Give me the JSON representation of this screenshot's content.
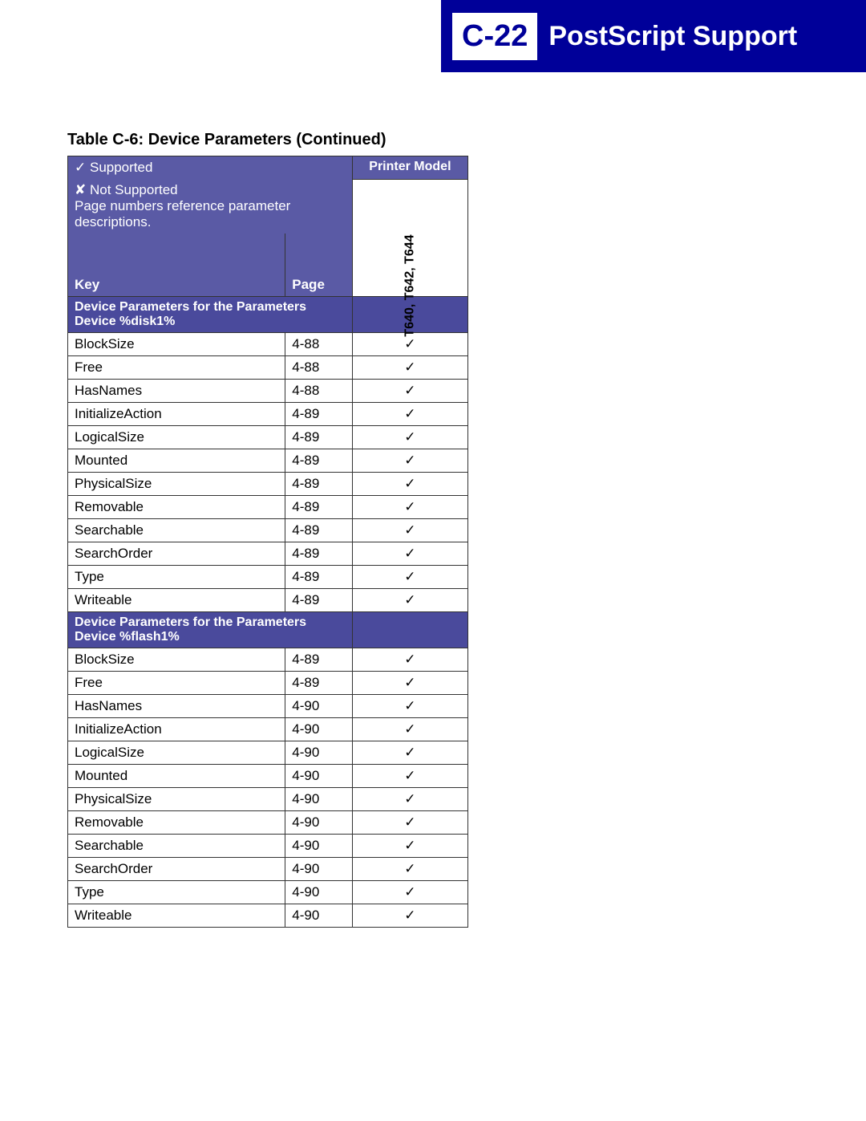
{
  "header": {
    "page_number": "C-22",
    "title": "PostScript Support"
  },
  "caption": "Table C-6:  Device Parameters (Continued)",
  "legend": {
    "supported": "Supported",
    "not_supported": "Not Supported",
    "note": "Page numbers reference parameter descriptions."
  },
  "columns": {
    "key": "Key",
    "page": "Page",
    "printer_model": "Printer Model",
    "model_label": "T640, T642, T644"
  },
  "sections": [
    {
      "heading": "Device Parameters for the Parameters Device %disk1%",
      "rows": [
        {
          "key": "BlockSize",
          "page": "4-88",
          "supported": true
        },
        {
          "key": "Free",
          "page": "4-88",
          "supported": true
        },
        {
          "key": "HasNames",
          "page": "4-88",
          "supported": true
        },
        {
          "key": "InitializeAction",
          "page": "4-89",
          "supported": true
        },
        {
          "key": "LogicalSize",
          "page": "4-89",
          "supported": true
        },
        {
          "key": "Mounted",
          "page": "4-89",
          "supported": true
        },
        {
          "key": "PhysicalSize",
          "page": "4-89",
          "supported": true
        },
        {
          "key": "Removable",
          "page": "4-89",
          "supported": true
        },
        {
          "key": "Searchable",
          "page": "4-89",
          "supported": true
        },
        {
          "key": "SearchOrder",
          "page": "4-89",
          "supported": true
        },
        {
          "key": "Type",
          "page": "4-89",
          "supported": true
        },
        {
          "key": "Writeable",
          "page": "4-89",
          "supported": true
        }
      ]
    },
    {
      "heading": "Device Parameters for the Parameters Device %flash1%",
      "rows": [
        {
          "key": "BlockSize",
          "page": "4-89",
          "supported": true
        },
        {
          "key": "Free",
          "page": "4-89",
          "supported": true
        },
        {
          "key": "HasNames",
          "page": "4-90",
          "supported": true
        },
        {
          "key": "InitializeAction",
          "page": "4-90",
          "supported": true
        },
        {
          "key": "LogicalSize",
          "page": "4-90",
          "supported": true
        },
        {
          "key": "Mounted",
          "page": "4-90",
          "supported": true
        },
        {
          "key": "PhysicalSize",
          "page": "4-90",
          "supported": true
        },
        {
          "key": "Removable",
          "page": "4-90",
          "supported": true
        },
        {
          "key": "Searchable",
          "page": "4-90",
          "supported": true
        },
        {
          "key": "SearchOrder",
          "page": "4-90",
          "supported": true
        },
        {
          "key": "Type",
          "page": "4-90",
          "supported": true
        },
        {
          "key": "Writeable",
          "page": "4-90",
          "supported": true
        }
      ]
    }
  ]
}
